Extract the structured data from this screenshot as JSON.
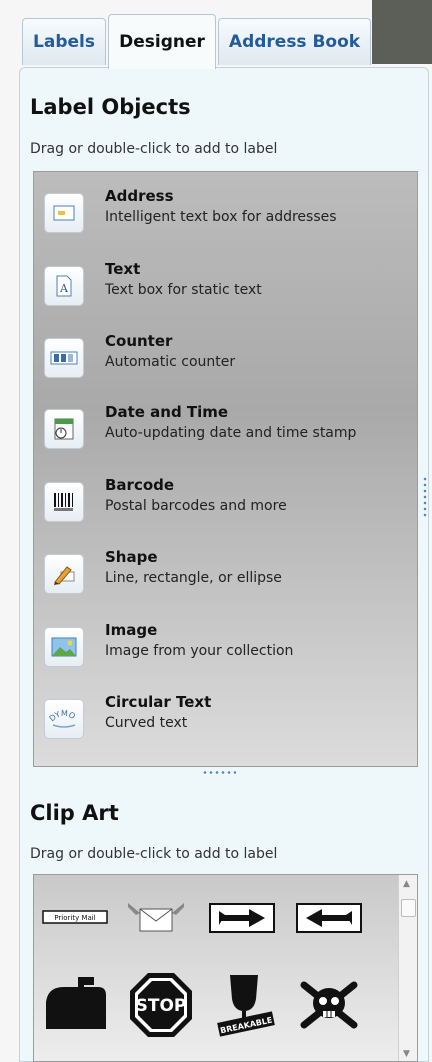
{
  "tabs": [
    "Labels",
    "Designer",
    "Address Book"
  ],
  "label_objects": {
    "title": "Label Objects",
    "hint": "Drag or double-click to add to label",
    "items": [
      {
        "title": "Address",
        "desc": "Intelligent text box for addresses",
        "icon": "address-card-icon"
      },
      {
        "title": "Text",
        "desc": "Text box for static text",
        "icon": "text-icon"
      },
      {
        "title": "Counter",
        "desc": "Automatic counter",
        "icon": "counter-icon"
      },
      {
        "title": "Date and Time",
        "desc": "Auto-updating date and time stamp",
        "icon": "calendar-clock-icon"
      },
      {
        "title": "Barcode",
        "desc": "Postal barcodes and more",
        "icon": "barcode-icon"
      },
      {
        "title": "Shape",
        "desc": "Line, rectangle, or ellipse",
        "icon": "pencil-shape-icon"
      },
      {
        "title": "Image",
        "desc": "Image from your collection",
        "icon": "image-icon"
      },
      {
        "title": "Circular Text",
        "desc": "Curved text",
        "icon": "circular-text-icon"
      }
    ]
  },
  "clip_art": {
    "title": "Clip Art",
    "hint": "Drag or double-click to add to label",
    "priority_mail_label": "Priority Mail",
    "stop_label": "STOP",
    "breakable_label": "BREAKABLE",
    "items": [
      "priority-mail-clipart",
      "envelope-wings-clipart",
      "arrow-right-clipart",
      "arrow-left-clipart",
      "mailbox-clipart",
      "stop-sign-clipart",
      "breakable-glass-clipart",
      "skull-crossbones-clipart"
    ]
  }
}
